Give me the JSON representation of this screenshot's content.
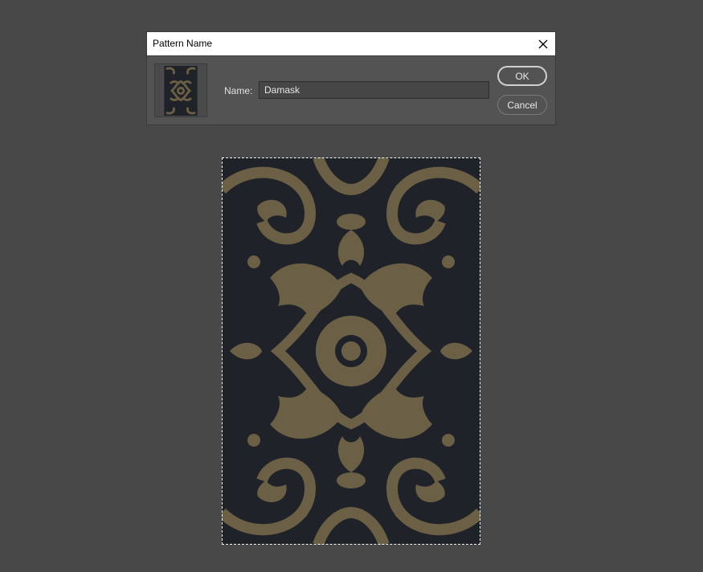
{
  "dialog": {
    "title": "Pattern Name",
    "name_label": "Name:",
    "name_value": "Damask",
    "ok_label": "OK",
    "cancel_label": "Cancel",
    "close_icon": "close-icon"
  },
  "colors": {
    "workspace": "#484848",
    "dialog_bg": "#535353",
    "pattern_bg": "#1f2228",
    "pattern_motif": "#6b5f45"
  }
}
